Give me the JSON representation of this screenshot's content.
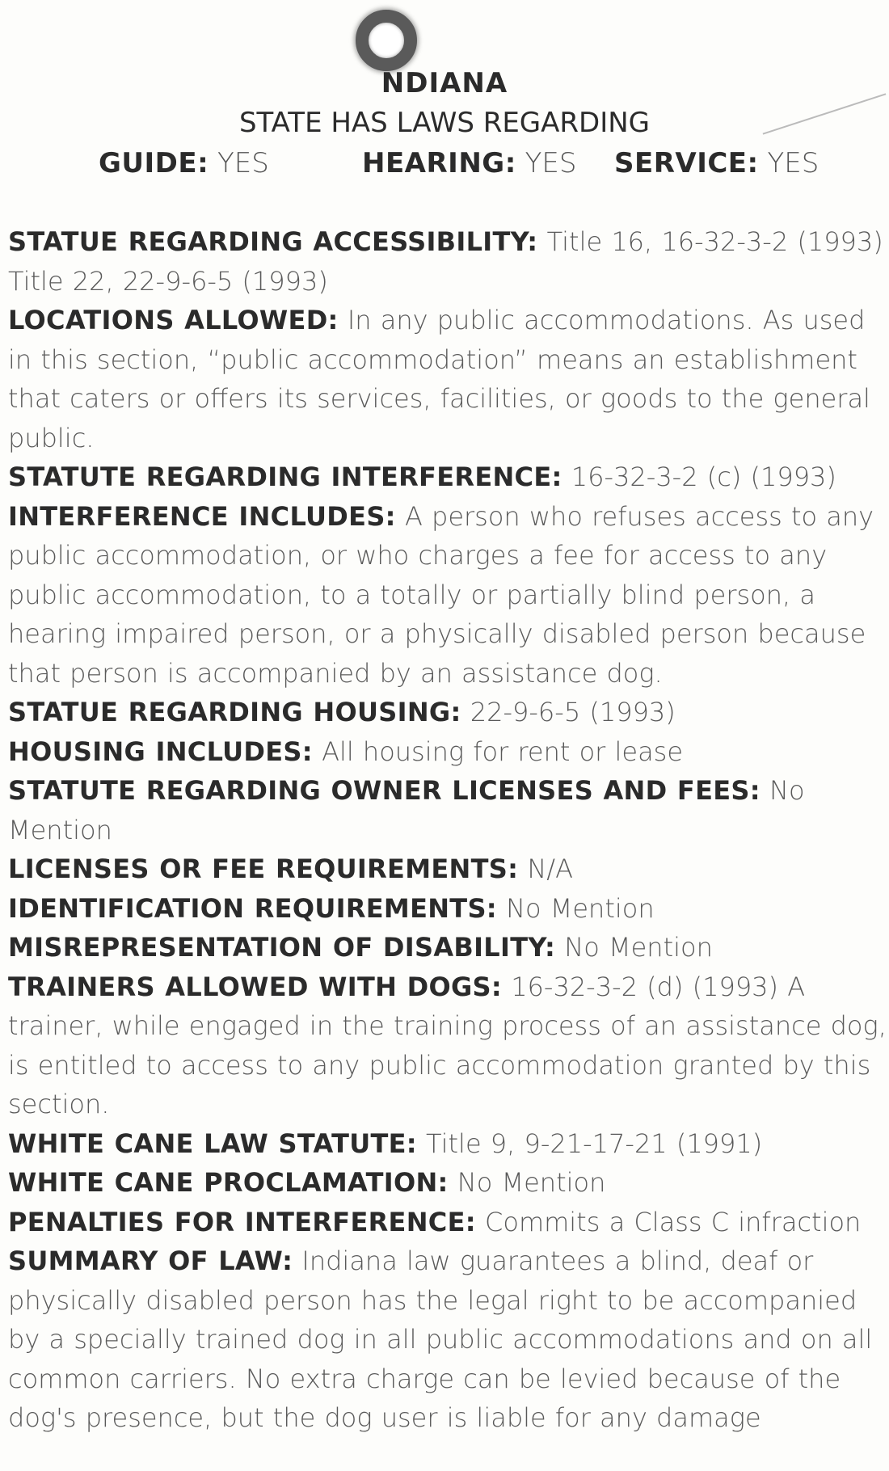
{
  "header": {
    "state_name": "NDIANA",
    "state_has_laws": "STATE HAS LAWS REGARDING",
    "guide_label": "GUIDE:",
    "guide_value": "YES",
    "hearing_label": "HEARING:",
    "hearing_value": "YES",
    "service_label": "SERVICE:",
    "service_value": "YES"
  },
  "sections": [
    {
      "label": "STATUE REGARDING ACCESSIBILITY:",
      "value": "Title 16, 16-32-3-2 (1993) Title 22, 22-9-6-5 (1993)"
    },
    {
      "label": "LOCATIONS ALLOWED:",
      "value": "In any public accommodations. As used in this section, “public accommodation” means an establishment that caters or offers its services, facilities, or goods to the general public."
    },
    {
      "label": "STATUTE REGARDING INTERFERENCE:",
      "value": "16-32-3-2 (c) (1993)"
    },
    {
      "label": "INTERFERENCE INCLUDES:",
      "value": "A person who refuses access to any public accommodation, or who charges a fee for access to any public accommodation, to a totally or partially blind person, a hearing impaired person, or a physically disabled person because that person is accompanied by an assistance dog."
    },
    {
      "label": "STATUE REGARDING HOUSING:",
      "value": "22-9-6-5 (1993)"
    },
    {
      "label": "HOUSING INCLUDES:",
      "value": "All housing for rent or lease"
    },
    {
      "label": "STATUTE REGARDING OWNER LICENSES AND FEES:",
      "value": "No Mention"
    },
    {
      "label": "LICENSES OR FEE REQUIREMENTS:",
      "value": "N/A"
    },
    {
      "label": "IDENTIFICATION REQUIREMENTS:",
      "value": "No Mention"
    },
    {
      "label": "MISREPRESENTATION OF DISABILITY:",
      "value": "No Mention"
    },
    {
      "label": "TRAINERS ALLOWED WITH DOGS:",
      "value": "16-32-3-2 (d) (1993) A trainer, while engaged in the training process of an assistance dog, is entitled to access to any public accommodation granted by this section."
    },
    {
      "label": "WHITE CANE LAW STATUTE:",
      "value": "Title 9, 9-21-17-21 (1991)"
    },
    {
      "label": "WHITE CANE PROCLAMATION:",
      "value": "No Mention"
    },
    {
      "label": "PENALTIES FOR INTERFERENCE:",
      "value": "Commits a Class C infraction"
    },
    {
      "label": "SUMMARY OF LAW:",
      "value": "Indiana law guarantees a blind, deaf or physically disabled person has the legal right to be accompanied by a specially trained dog in all public accommodations and on all common carriers. No extra charge can be levied because of the dog's presence, but the dog user is liable for any damage"
    }
  ]
}
